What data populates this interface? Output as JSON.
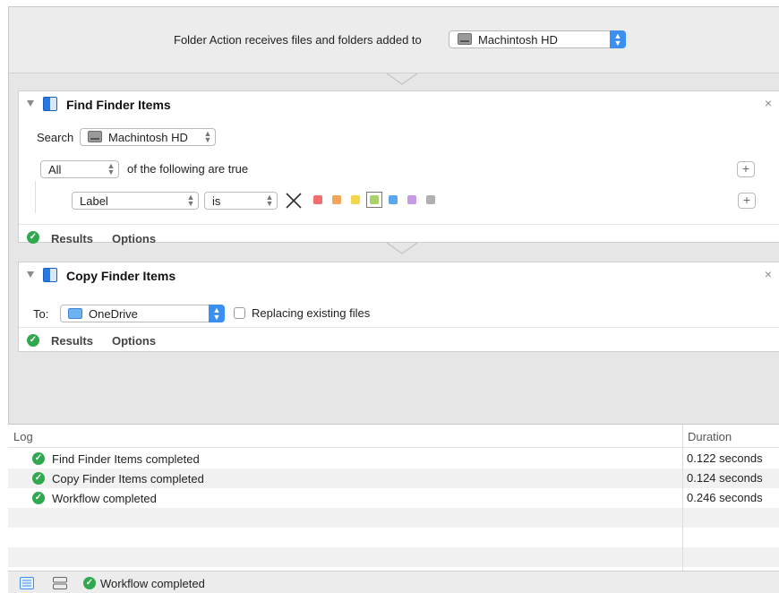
{
  "header": {
    "label": "Folder Action receives files and folders added to",
    "folder_value": "Machintosh HD"
  },
  "actions": [
    {
      "title": "Find Finder Items",
      "search_label": "Search",
      "search_value": "Machintosh HD",
      "match_value": "All",
      "match_suffix": "of the following are true",
      "criterion_field": "Label",
      "criterion_operator": "is",
      "label_colors": [
        "#f26d6d",
        "#f5a55a",
        "#f2d54a",
        "#a8d26a",
        "#5aa7ef",
        "#c79ae5",
        "#b0b0b0"
      ],
      "selected_color_index": 3,
      "results_label": "Results",
      "options_label": "Options"
    },
    {
      "title": "Copy Finder Items",
      "to_label": "To:",
      "to_value": "OneDrive",
      "replace_label": "Replacing existing files",
      "replace_checked": false,
      "results_label": "Results",
      "options_label": "Options"
    }
  ],
  "log": {
    "header_log": "Log",
    "header_duration": "Duration",
    "rows": [
      {
        "message": "Find Finder Items completed",
        "duration": "0.122 seconds"
      },
      {
        "message": "Copy Finder Items completed",
        "duration": "0.124 seconds"
      },
      {
        "message": "Workflow completed",
        "duration": "0.246 seconds"
      }
    ]
  },
  "status": {
    "text": "Workflow completed"
  },
  "icons": {
    "close": "close-icon",
    "disclosure": "disclosure-triangle-icon",
    "finder": "finder-icon",
    "hard_drive": "hard-drive-icon",
    "cloud_folder": "cloud-folder-icon",
    "success": "check-circle-icon",
    "log_view": "list-icon",
    "variables_view": "variables-icon"
  },
  "colors": {
    "success": "#2fa84f",
    "accent": "#3b8ff0"
  }
}
